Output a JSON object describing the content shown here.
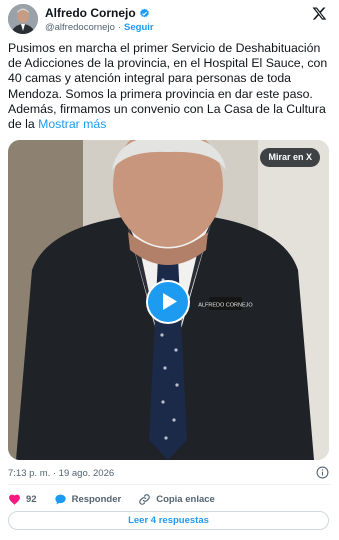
{
  "author": {
    "name": "Alfredo Cornejo",
    "handle": "@alfredocornejo",
    "follow_label": "Seguir",
    "verified_icon": "verified-badge-icon"
  },
  "platform_icon": "x-logo-icon",
  "tweet": {
    "text": "Pusimos en marcha el primer Servicio de Deshabituación de Adicciones de la provincia, en el Hospital El Sauce, con 40 camas y atención integral para personas de toda Mendoza. Somos la primera provincia en dar este paso. Además, firmamos un convenio con La Casa de la Cultura de la",
    "show_more": "Mostrar más"
  },
  "video": {
    "watch_label": "Mirar en X",
    "play_icon": "play-icon",
    "badge_text": "ALFREDO CORNEJO"
  },
  "timestamp": "7:13 p. m. · 19 ago. 2026",
  "actions": {
    "likes": "92",
    "reply_label": "Responder",
    "copy_label": "Copia enlace"
  },
  "replies_button": "Leer 4 respuestas",
  "colors": {
    "accent": "#1d9bf0",
    "like": "#f91880",
    "text": "#0f1419",
    "muted": "#536471"
  }
}
